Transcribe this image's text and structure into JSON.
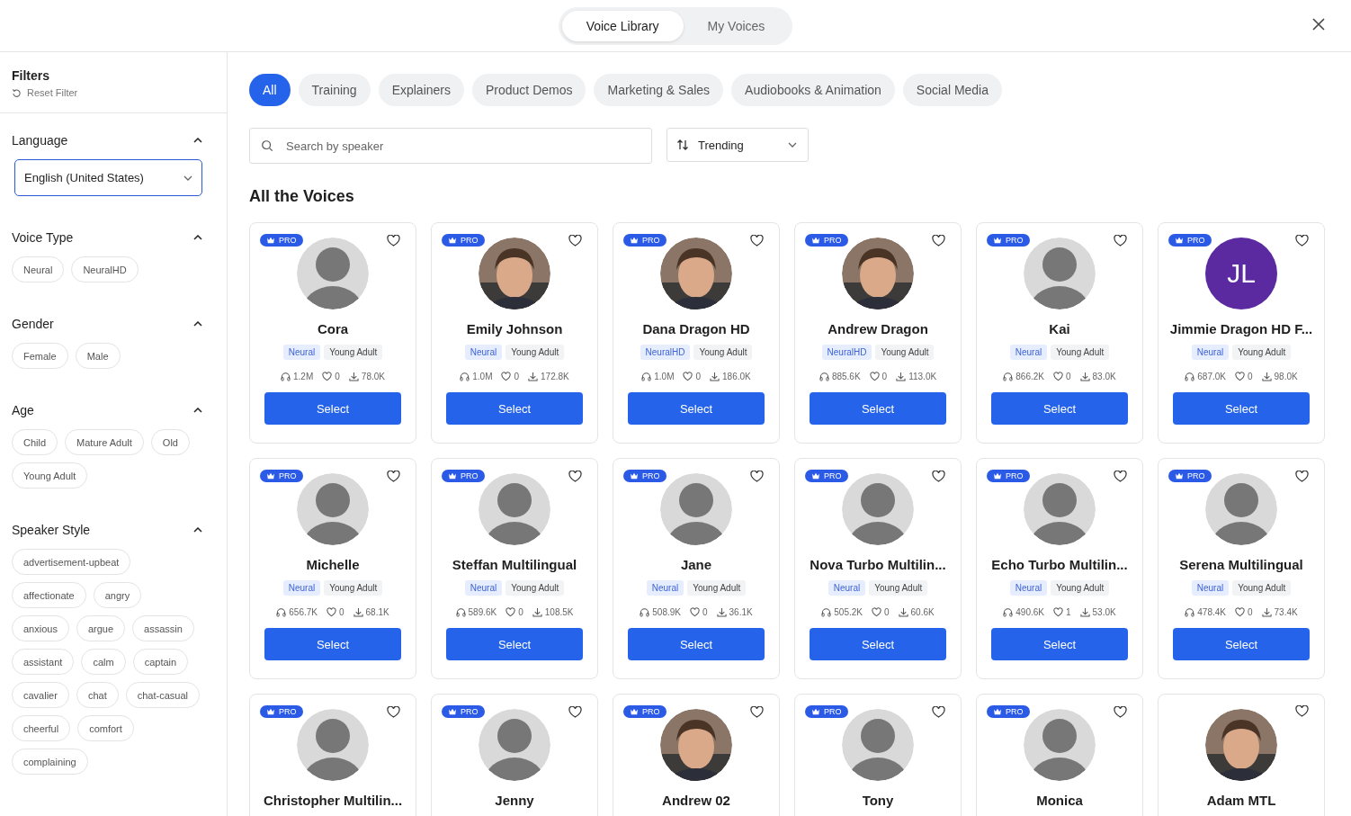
{
  "header": {
    "tabs": [
      {
        "label": "Voice Library",
        "selected": true
      },
      {
        "label": "My Voices",
        "selected": false
      }
    ]
  },
  "filters": {
    "title": "Filters",
    "reset": "Reset Filter",
    "sections": [
      {
        "title": "Language",
        "expanded": true,
        "kind": "select",
        "value": "English (United States)"
      },
      {
        "title": "Voice Type",
        "expanded": true,
        "kind": "chips",
        "chips": [
          "Neural",
          "NeuralHD"
        ]
      },
      {
        "title": "Gender",
        "expanded": true,
        "kind": "chips",
        "chips": [
          "Female",
          "Male"
        ]
      },
      {
        "title": "Age",
        "expanded": true,
        "kind": "chips",
        "chips": [
          "Child",
          "Mature Adult",
          "Old",
          "Young Adult"
        ]
      },
      {
        "title": "Speaker Style",
        "expanded": true,
        "kind": "chips",
        "chips": [
          "advertisement-upbeat",
          "affectionate",
          "angry",
          "anxious",
          "argue",
          "assassin",
          "assistant",
          "calm",
          "captain",
          "cavalier",
          "chat",
          "chat-casual",
          "cheerful",
          "comfort",
          "complaining"
        ]
      }
    ]
  },
  "categories": [
    {
      "label": "All",
      "selected": true
    },
    {
      "label": "Training",
      "selected": false
    },
    {
      "label": "Explainers",
      "selected": false
    },
    {
      "label": "Product Demos",
      "selected": false
    },
    {
      "label": "Marketing & Sales",
      "selected": false
    },
    {
      "label": "Audiobooks & Animation",
      "selected": false
    },
    {
      "label": "Social Media",
      "selected": false
    }
  ],
  "search": {
    "placeholder": "Search by speaker"
  },
  "sort": {
    "value": "Trending"
  },
  "section_title": "All the Voices",
  "voices": [
    {
      "name": "Cora",
      "pro": "PRO",
      "avatar": {
        "kind": "default"
      },
      "tags": [
        "Neural",
        "Young Adult"
      ],
      "plays": "1.2M",
      "likes": "0",
      "downloads": "78.0K",
      "button": "Select"
    },
    {
      "name": "Emily Johnson",
      "pro": "PRO",
      "tags": [
        "Neural",
        "Young Adult"
      ],
      "plays": "1.0M",
      "likes": "0",
      "downloads": "172.8K",
      "button": "Select"
    },
    {
      "name": "Dana Dragon HD",
      "pro": "PRO",
      "tags": [
        "NeuralHD",
        "Young Adult"
      ],
      "plays": "1.0M",
      "likes": "0",
      "downloads": "186.0K",
      "button": "Select"
    },
    {
      "name": "Andrew Dragon",
      "pro": "PRO",
      "tags": [
        "NeuralHD",
        "Young Adult"
      ],
      "plays": "885.6K",
      "likes": "0",
      "downloads": "113.0K",
      "button": "Select"
    },
    {
      "name": "Kai",
      "pro": "PRO",
      "avatar": {
        "kind": "default"
      },
      "tags": [
        "Neural",
        "Young Adult"
      ],
      "plays": "866.2K",
      "likes": "0",
      "downloads": "83.0K",
      "button": "Select"
    },
    {
      "name": "Jimmie Dragon HD F...",
      "pro": "PRO",
      "avatar": {
        "kind": "initials",
        "text": "JL"
      },
      "tags": [
        "Neural",
        "Young Adult"
      ],
      "plays": "687.0K",
      "likes": "0",
      "downloads": "98.0K",
      "button": "Select"
    },
    {
      "name": "Michelle",
      "pro": "PRO",
      "avatar": {
        "kind": "default"
      },
      "tags": [
        "Neural",
        "Young Adult"
      ],
      "plays": "656.7K",
      "likes": "0",
      "downloads": "68.1K",
      "button": "Select"
    },
    {
      "name": "Steffan Multilingual",
      "pro": "PRO",
      "avatar": {
        "kind": "default"
      },
      "tags": [
        "Neural",
        "Young Adult"
      ],
      "plays": "589.6K",
      "likes": "0",
      "downloads": "108.5K",
      "button": "Select"
    },
    {
      "name": "Jane",
      "pro": "PRO",
      "avatar": {
        "kind": "default"
      },
      "tags": [
        "Neural",
        "Young Adult"
      ],
      "plays": "508.9K",
      "likes": "0",
      "downloads": "36.1K",
      "button": "Select"
    },
    {
      "name": "Nova Turbo Multilin...",
      "pro": "PRO",
      "avatar": {
        "kind": "default"
      },
      "tags": [
        "Neural",
        "Young Adult"
      ],
      "plays": "505.2K",
      "likes": "0",
      "downloads": "60.6K",
      "button": "Select"
    },
    {
      "name": "Echo Turbo Multilin...",
      "pro": "PRO",
      "avatar": {
        "kind": "default"
      },
      "tags": [
        "Neural",
        "Young Adult"
      ],
      "plays": "490.6K",
      "likes": "1",
      "downloads": "53.0K",
      "button": "Select"
    },
    {
      "name": "Serena Multilingual",
      "pro": "PRO",
      "avatar": {
        "kind": "default"
      },
      "tags": [
        "Neural",
        "Young Adult"
      ],
      "plays": "478.4K",
      "likes": "0",
      "downloads": "73.4K",
      "button": "Select"
    },
    {
      "name": "Christopher Multilin...",
      "pro": "PRO",
      "avatar": {
        "kind": "default"
      }
    },
    {
      "name": "Jenny",
      "pro": "PRO",
      "avatar": {
        "kind": "default"
      }
    },
    {
      "name": "Andrew 02",
      "pro": "PRO"
    },
    {
      "name": "Tony",
      "pro": "PRO",
      "avatar": {
        "kind": "default"
      }
    },
    {
      "name": "Monica",
      "pro": "PRO",
      "avatar": {
        "kind": "default"
      }
    },
    {
      "name": "Adam MTL"
    }
  ]
}
